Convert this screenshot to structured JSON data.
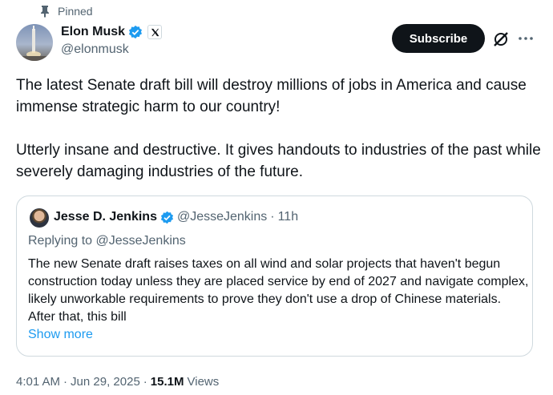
{
  "pinned_label": "Pinned",
  "author": {
    "name": "Elon Musk",
    "handle": "@elonmusk"
  },
  "subscribe_label": "Subscribe",
  "tweet_paragraphs": [
    "The latest Senate draft bill will destroy millions of jobs in America and cause immense strategic harm to our country!",
    "Utterly insane and destructive. It gives handouts to industries of the past while severely damaging industries of the future."
  ],
  "quote": {
    "name": "Jesse D. Jenkins",
    "handle": "@JesseJenkins",
    "separator": "·",
    "time": "11h",
    "replying_to": "Replying to @JesseJenkins",
    "text": "The new Senate draft raises taxes on all wind and solar projects that haven't begun construction today unless they are placed service by end of 2027 and navigate complex, likely unworkable requirements to prove they don't use a drop of Chinese materials. After that, this bill",
    "show_more": "Show more"
  },
  "meta": {
    "time": "4:01 AM",
    "separator": "·",
    "date": "Jun 29, 2025",
    "views_count": "15.1M",
    "views_label": "Views"
  },
  "colors": {
    "verified": "#1d9bf0",
    "link": "#1d9bf0",
    "muted": "#536471",
    "text": "#0f1419"
  },
  "icons": [
    "pin-icon",
    "verified-icon",
    "x-logo-icon",
    "grok-icon",
    "more-icon"
  ]
}
